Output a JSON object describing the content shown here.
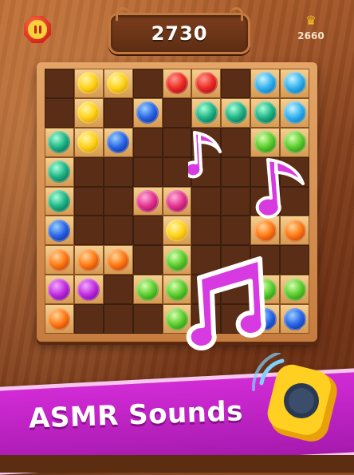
{
  "header": {
    "score": "2730",
    "best_score": "2660",
    "pause_icon": "pause-icon",
    "crown_icon": "crown-icon"
  },
  "board": {
    "rows": [
      [
        "empty",
        "yellow",
        "yellow",
        "empty",
        "red",
        "red",
        "empty",
        "cyan",
        "cyan"
      ],
      [
        "empty",
        "yellow",
        "empty",
        "blue",
        "empty",
        "teal",
        "teal",
        "teal",
        "cyan"
      ],
      [
        "teal",
        "yellow",
        "blue",
        "empty",
        "empty",
        "empty",
        "empty",
        "green",
        "green"
      ],
      [
        "teal",
        "empty",
        "empty",
        "empty",
        "empty",
        "empty",
        "empty",
        "empty",
        "empty"
      ],
      [
        "teal",
        "empty",
        "empty",
        "pink",
        "pink",
        "empty",
        "empty",
        "empty",
        "empty"
      ],
      [
        "blue",
        "empty",
        "empty",
        "empty",
        "yellow",
        "empty",
        "empty",
        "orange",
        "orange"
      ],
      [
        "orange",
        "orange",
        "orange",
        "empty",
        "green",
        "empty",
        "empty",
        "empty",
        "empty"
      ],
      [
        "purple",
        "purple",
        "empty",
        "green",
        "green",
        "empty",
        "empty",
        "green",
        "green"
      ],
      [
        "orange",
        "empty",
        "empty",
        "empty",
        "green",
        "empty",
        "empty",
        "blue",
        "blue"
      ]
    ]
  },
  "decorations": {
    "notes": [
      "music-note-icon",
      "music-note-icon",
      "music-note-icon"
    ],
    "speaker_icon": "speaker-icon"
  },
  "banner": {
    "text": "ASMR Sounds"
  },
  "colors": {
    "yellow": "#ffd21a",
    "red": "#ee2a26",
    "blue": "#2a66e6",
    "cyan": "#33b2ef",
    "teal": "#1fb587",
    "green": "#5cce2e",
    "pink": "#e5328e",
    "orange": "#ff7a14",
    "purple": "#c12ce0",
    "banner": "#c823cc",
    "note": "#d63ae0"
  }
}
